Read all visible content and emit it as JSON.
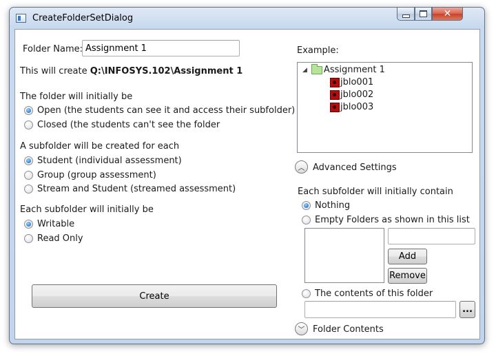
{
  "window": {
    "title": "CreateFolderSetDialog"
  },
  "folder_name": {
    "label": "Folder Name:",
    "value": "Assignment 1"
  },
  "create_path": {
    "prefix": "This will create ",
    "path": "Q:\\INFOSYS.102\\Assignment 1"
  },
  "visibility": {
    "heading": "The folder will initially be",
    "options": [
      {
        "label": "Open (the students can see it and access their subfolder)",
        "checked": true
      },
      {
        "label": "Closed (the students can't see the folder",
        "checked": false
      }
    ]
  },
  "subfolder_type": {
    "heading": "A subfolder will be created for each",
    "options": [
      {
        "label": "Student (individual assessment)",
        "checked": true
      },
      {
        "label": "Group (group assessment)",
        "checked": false
      },
      {
        "label": "Stream and Student (streamed assessment)",
        "checked": false
      }
    ]
  },
  "permission": {
    "heading": "Each subfolder will initially be",
    "options": [
      {
        "label": "Writable",
        "checked": true
      },
      {
        "label": "Read Only",
        "checked": false
      }
    ]
  },
  "create_button": "Create",
  "example": {
    "label": "Example:",
    "root": "Assignment 1",
    "children": [
      "jblo001",
      "jblo002",
      "jblo003"
    ]
  },
  "advanced_settings": "Advanced Settings",
  "contents": {
    "heading": "Each subfolder will initially contain",
    "options": [
      {
        "label": "Nothing",
        "checked": true
      },
      {
        "label": "Empty Folders as shown in this list",
        "checked": false
      },
      {
        "label": "The contents of this folder",
        "checked": false
      }
    ],
    "add_button": "Add",
    "remove_button": "Remove",
    "browse_button": "...",
    "new_folder_value": "",
    "contents_folder_value": ""
  },
  "folder_contents": "Folder Contents"
}
